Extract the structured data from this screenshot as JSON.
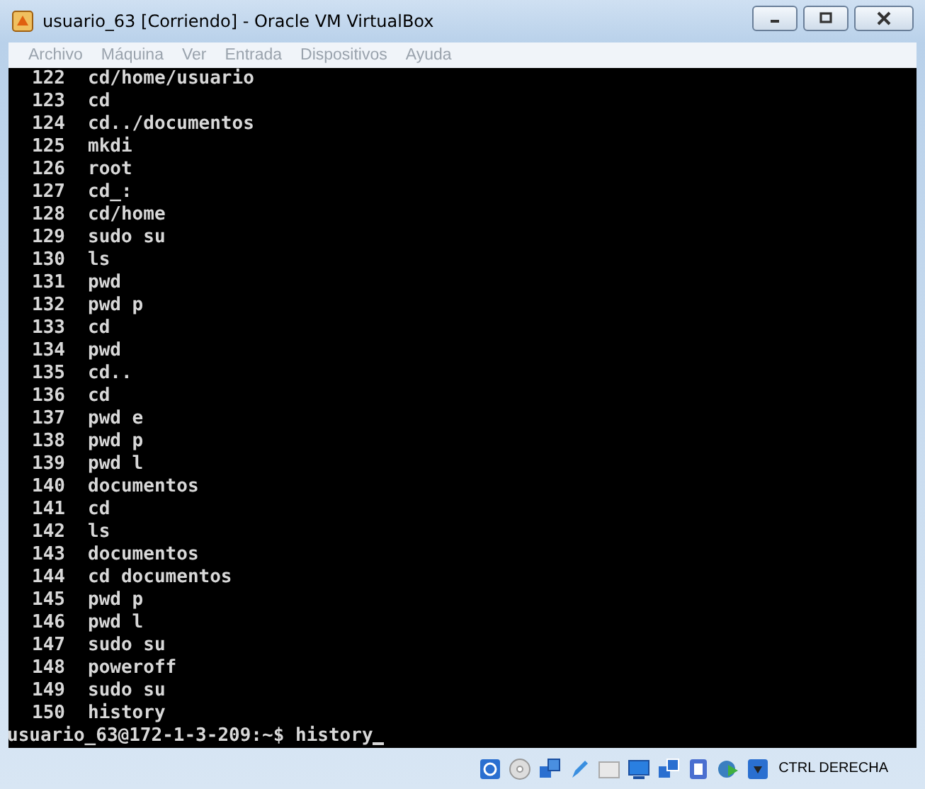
{
  "window": {
    "title": "usuario_63 [Corriendo] - Oracle VM VirtualBox"
  },
  "menu": [
    {
      "label": "Archivo",
      "disabled": true
    },
    {
      "label": "Máquina",
      "disabled": true
    },
    {
      "label": "Ver",
      "disabled": true
    },
    {
      "label": "Entrada",
      "disabled": true
    },
    {
      "label": "Dispositivos",
      "disabled": true
    },
    {
      "label": "Ayuda",
      "disabled": true
    }
  ],
  "terminal": {
    "history": [
      {
        "number": "122",
        "command": "cd/home/usuario"
      },
      {
        "number": "123",
        "command": "cd"
      },
      {
        "number": "124",
        "command": "cd../documentos"
      },
      {
        "number": "125",
        "command": "mkdi"
      },
      {
        "number": "126",
        "command": "root"
      },
      {
        "number": "127",
        "command": "cd_:"
      },
      {
        "number": "128",
        "command": "cd/home"
      },
      {
        "number": "129",
        "command": "sudo su"
      },
      {
        "number": "130",
        "command": "ls"
      },
      {
        "number": "131",
        "command": "pwd"
      },
      {
        "number": "132",
        "command": "pwd p"
      },
      {
        "number": "133",
        "command": "cd"
      },
      {
        "number": "134",
        "command": "pwd"
      },
      {
        "number": "135",
        "command": "cd.."
      },
      {
        "number": "136",
        "command": "cd"
      },
      {
        "number": "137",
        "command": "pwd e"
      },
      {
        "number": "138",
        "command": "pwd p"
      },
      {
        "number": "139",
        "command": "pwd l"
      },
      {
        "number": "140",
        "command": "documentos"
      },
      {
        "number": "141",
        "command": "cd"
      },
      {
        "number": "142",
        "command": "ls"
      },
      {
        "number": "143",
        "command": "documentos"
      },
      {
        "number": "144",
        "command": "cd documentos"
      },
      {
        "number": "145",
        "command": "pwd p"
      },
      {
        "number": "146",
        "command": "pwd l"
      },
      {
        "number": "147",
        "command": "sudo su"
      },
      {
        "number": "148",
        "command": "poweroff"
      },
      {
        "number": "149",
        "command": "sudo su"
      },
      {
        "number": "150",
        "command": "history"
      }
    ],
    "prompt": "usuario_63@172-1-3-209:~$ history"
  },
  "status_bar": {
    "host_key": "CTRL DERECHA"
  }
}
